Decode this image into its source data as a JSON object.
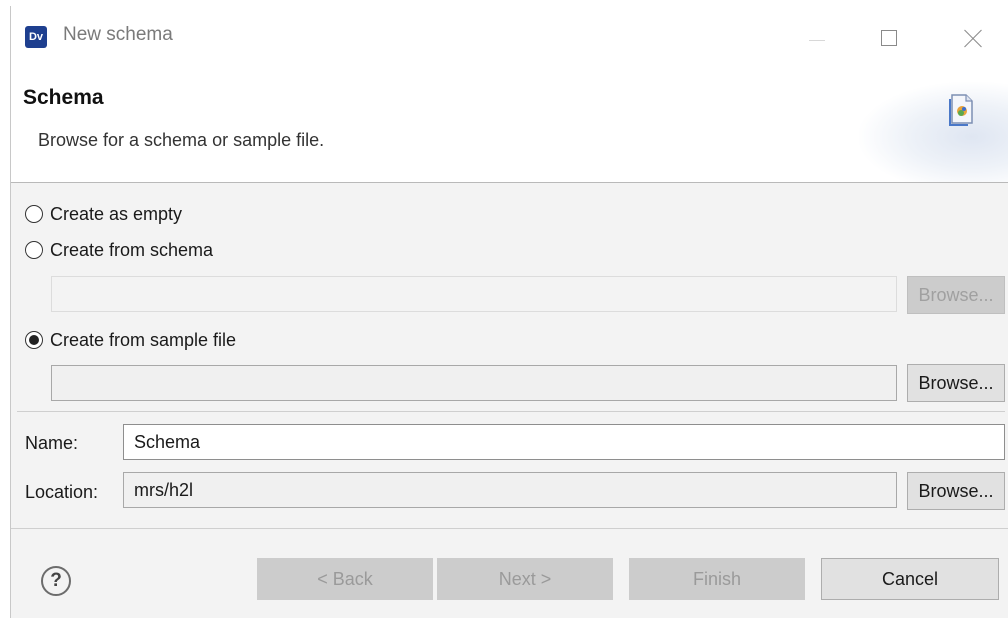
{
  "window": {
    "app_icon_text": "Dv",
    "title": "New schema"
  },
  "banner": {
    "title": "Schema",
    "description": "Browse for a schema or sample file."
  },
  "options": [
    {
      "label": "Create as empty",
      "selected": false
    },
    {
      "label": "Create from schema",
      "selected": false
    },
    {
      "label": "Create from sample file",
      "selected": true
    }
  ],
  "schema_path": {
    "value": "",
    "browse_label": "Browse...",
    "enabled": false
  },
  "sample_path": {
    "value": "",
    "browse_label": "Browse...",
    "enabled": true
  },
  "name": {
    "label": "Name:",
    "value": "Schema"
  },
  "location": {
    "label": "Location:",
    "value": "mrs/h2l",
    "browse_label": "Browse..."
  },
  "buttons": {
    "help": "?",
    "back": "< Back",
    "next": "Next >",
    "finish": "Finish",
    "cancel": "Cancel"
  }
}
